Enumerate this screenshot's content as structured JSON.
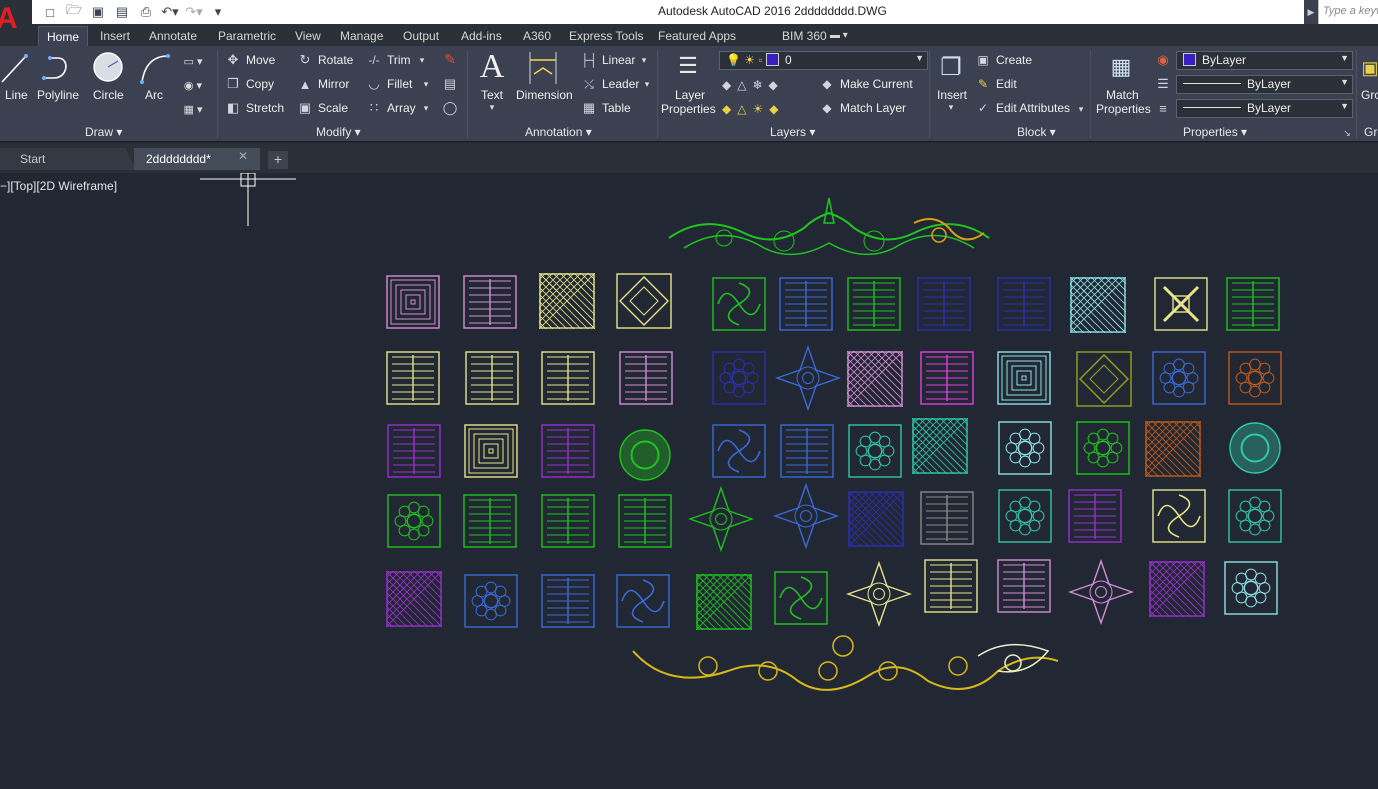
{
  "window": {
    "title": "Autodesk AutoCAD 2016    2dddddddd.DWG",
    "search_placeholder": "Type a keyw"
  },
  "ribbon_tabs": [
    "Home",
    "Insert",
    "Annotate",
    "Parametric",
    "View",
    "Manage",
    "Output",
    "Add-ins",
    "A360",
    "Express Tools",
    "Featured Apps",
    "BIM 360"
  ],
  "panels": {
    "draw": {
      "title": "Draw",
      "line": "Line",
      "polyline": "Polyline",
      "circle": "Circle",
      "arc": "Arc"
    },
    "modify": {
      "title": "Modify",
      "move": "Move",
      "rotate": "Rotate",
      "trim": "Trim",
      "copy": "Copy",
      "mirror": "Mirror",
      "fillet": "Fillet",
      "stretch": "Stretch",
      "scale": "Scale",
      "array": "Array"
    },
    "annotation": {
      "title": "Annotation",
      "text": "Text",
      "dimension": "Dimension",
      "linear": "Linear",
      "leader": "Leader",
      "table": "Table"
    },
    "layers": {
      "title": "Layers",
      "layer_properties_1": "Layer",
      "layer_properties_2": "Properties",
      "current_layer": "0",
      "make_current": "Make Current",
      "match_layer": "Match Layer"
    },
    "block": {
      "title": "Block",
      "insert": "Insert",
      "create": "Create",
      "edit": "Edit",
      "edit_attributes": "Edit Attributes"
    },
    "properties": {
      "title": "Properties",
      "match_1": "Match",
      "match_2": "Properties",
      "color": "ByLayer",
      "linetype": "ByLayer",
      "lineweight": "ByLayer"
    },
    "groups": {
      "title": "Gro",
      "label": "Gro"
    }
  },
  "doc_tabs": {
    "start": "Start",
    "file": "2dddddddd*"
  },
  "viewport_label": "−][Top][2D Wireframe]",
  "tile_colors": {
    "green": "#1fc41f",
    "lime": "#8ee04a",
    "yellow": "#e8e48a",
    "pink": "#d58cd8",
    "magenta": "#e040e0",
    "purple": "#9a2fd0",
    "blue": "#3a6ad8",
    "navy": "#2b2fb0",
    "cyan": "#8ee0e8",
    "teal": "#30c8a8",
    "orange": "#c05a1a",
    "olive": "#9aa020",
    "gray": "#8a8a8a",
    "gold": "#d8b818",
    "white": "#e8f0d0"
  }
}
